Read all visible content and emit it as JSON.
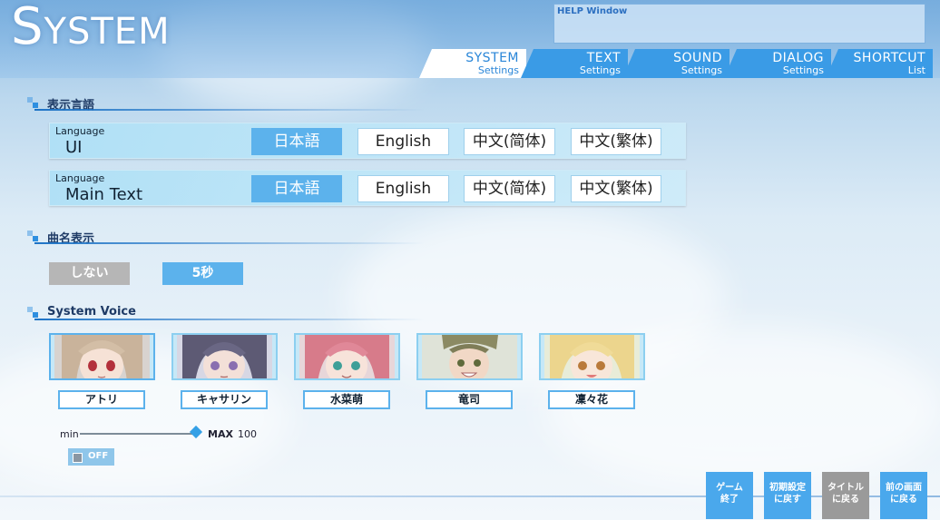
{
  "title": {
    "first_letter": "S",
    "rest": "YSTEM"
  },
  "help_window": {
    "label": "HELP Window"
  },
  "tabs": [
    {
      "label": "SYSTEM",
      "sub": "Settings",
      "active": true
    },
    {
      "label": "TEXT",
      "sub": "Settings",
      "active": false
    },
    {
      "label": "SOUND",
      "sub": "Settings",
      "active": false
    },
    {
      "label": "DIALOG",
      "sub": "Settings",
      "active": false
    },
    {
      "label": "SHORTCUT",
      "sub": "List",
      "active": false
    }
  ],
  "sections": {
    "display_language": "表示言語",
    "song_title_display": "曲名表示",
    "system_voice": "System Voice"
  },
  "language_rows": [
    {
      "small_label": "Language",
      "big_label": "UI"
    },
    {
      "small_label": "Language",
      "big_label": "Main Text"
    }
  ],
  "language_options": [
    "日本語",
    "English",
    "中文(简体)",
    "中文(繁体)"
  ],
  "selected_language_ui": "日本語",
  "selected_language_text": "日本語",
  "song_title_options": [
    "しない",
    "5秒"
  ],
  "song_title_selected": "5秒",
  "characters": [
    "アトリ",
    "キャサリン",
    "水菜萌",
    "竜司",
    "凜々花"
  ],
  "volume": {
    "min_label": "min",
    "max_label": "MAX",
    "value": "100"
  },
  "voice_toggle": {
    "label": "OFF"
  },
  "footer_buttons": [
    {
      "line1": "ゲーム",
      "line2": "終了"
    },
    {
      "line1": "初期設定",
      "line2": "に戻す"
    },
    {
      "line1": "タイトル",
      "line2": "に戻る"
    },
    {
      "line1": "前の画面",
      "line2": "に戻る"
    }
  ],
  "colors": {
    "accent": "#3a9be6",
    "selected": "#5cb2ec",
    "heading": "#1f3b66",
    "disabled": "#9a9a9a"
  }
}
